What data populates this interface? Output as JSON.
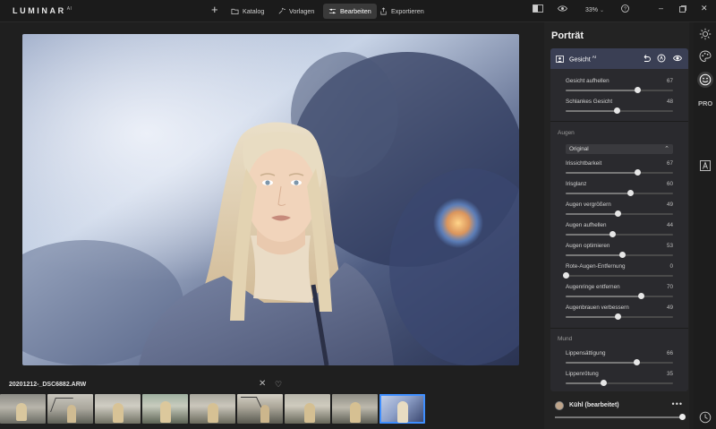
{
  "app": {
    "name": "LUMINAR",
    "suffix": "AI"
  },
  "toolbar": {
    "katalog": "Katalog",
    "vorlagen": "Vorlagen",
    "bearbeiten": "Bearbeiten",
    "exportieren": "Exportieren",
    "zoom": "33%"
  },
  "filmstrip": {
    "filename": "20201212-_DSC6882.ARW",
    "thumb_count": 9,
    "selected_index": 8
  },
  "panel": {
    "title": "Porträt",
    "tool_title": "Gesicht",
    "tool_badge": "AI",
    "sections": {
      "augen": "Augen",
      "mund": "Mund"
    },
    "eye_select": "Original",
    "sliders": [
      {
        "label": "Gesicht aufhellen",
        "value": 67,
        "section": "gesicht"
      },
      {
        "label": "Schlankes Gesicht",
        "value": 48,
        "section": "gesicht"
      },
      {
        "label": "Irissichtbarkeit",
        "value": 67,
        "section": "augen"
      },
      {
        "label": "Irisglanz",
        "value": 60,
        "section": "augen"
      },
      {
        "label": "Augen vergrößern",
        "value": 49,
        "section": "augen"
      },
      {
        "label": "Augen aufhellen",
        "value": 44,
        "section": "augen"
      },
      {
        "label": "Augen optimieren",
        "value": 53,
        "section": "augen"
      },
      {
        "label": "Rote-Augen-Entfernung",
        "value": 0,
        "section": "augen"
      },
      {
        "label": "Augenringe entfernen",
        "value": 70,
        "section": "augen"
      },
      {
        "label": "Augenbrauen verbessern",
        "value": 49,
        "section": "augen"
      },
      {
        "label": "Lippensättigung",
        "value": 66,
        "section": "mund"
      },
      {
        "label": "Lippenrötung",
        "value": 35,
        "section": "mund"
      }
    ]
  },
  "preset": {
    "name": "Kühl (bearbeitet)",
    "amount": 100
  },
  "colors": {
    "accent": "#3f8fff",
    "tool_header": "#3a3f54",
    "panel": "#232323"
  }
}
